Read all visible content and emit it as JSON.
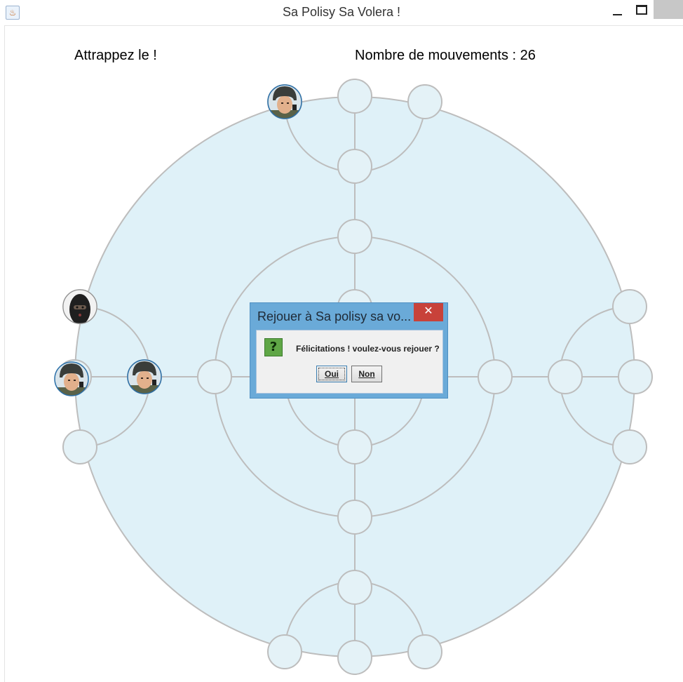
{
  "window": {
    "title": "Sa Polisy Sa Volera !",
    "icon": "java-cup-icon"
  },
  "game": {
    "label_catch": "Attrappez le !",
    "label_moves": "Nombre de mouvements : 26"
  },
  "colors": {
    "board_fill": "#dff1f8",
    "board_line": "#bdbdbd",
    "node_fill": "#e4f2f7"
  },
  "pieces": [
    {
      "role": "police",
      "icon": "police-officer-icon"
    },
    {
      "role": "police",
      "icon": "police-officer-icon"
    },
    {
      "role": "police",
      "icon": "police-officer-icon"
    },
    {
      "role": "thief",
      "icon": "thief-balaclava-icon"
    }
  ],
  "dialog": {
    "title": "Rejouer à Sa polisy sa vo...",
    "message": "Félicitations ! voulez-vous rejouer ?",
    "icon": "question-icon",
    "icon_glyph": "?",
    "close_glyph": "✕",
    "yes_label": "Oui",
    "no_label": "Non"
  }
}
